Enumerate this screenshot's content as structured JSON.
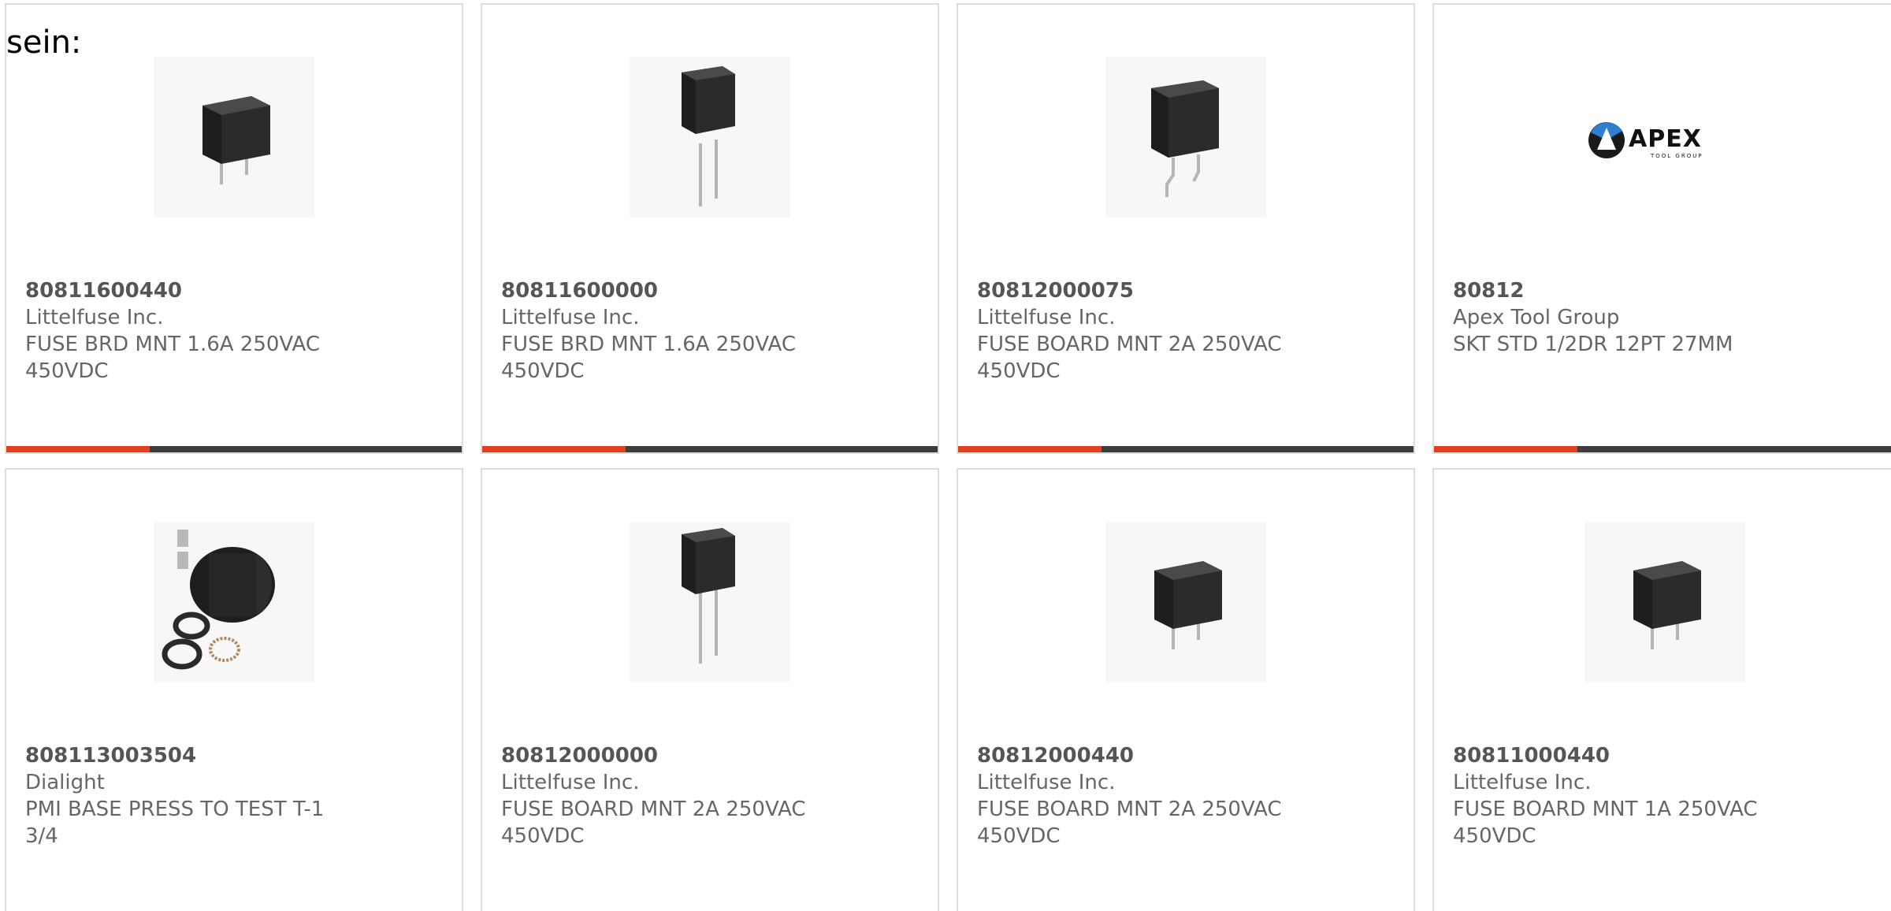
{
  "intro_text": "sein:",
  "colors": {
    "accent": "#e2401c",
    "bar": "#3d3d3d",
    "border": "#dddddd",
    "text": "#666666"
  },
  "products": [
    {
      "part_number": "80811600440",
      "manufacturer": "Littelfuse Inc.",
      "description": "FUSE BRD MNT 1.6A 250VAC 450VDC",
      "image": "fuse-short-leads"
    },
    {
      "part_number": "80811600000",
      "manufacturer": "Littelfuse Inc.",
      "description": "FUSE BRD MNT 1.6A 250VAC 450VDC",
      "image": "fuse-long-leads"
    },
    {
      "part_number": "80812000075",
      "manufacturer": "Littelfuse Inc.",
      "description": "FUSE BOARD MNT 2A 250VAC 450VDC",
      "image": "fuse-bent-leads"
    },
    {
      "part_number": "80812",
      "manufacturer": "Apex Tool Group",
      "description": "SKT STD 1/2DR 12PT 27MM",
      "image": "apex-logo",
      "logo_text": "APEX",
      "logo_subtext": "TOOL GROUP"
    },
    {
      "part_number": "808113003504",
      "manufacturer": "Dialight",
      "description": "PMI BASE PRESS TO TEST T-1 3/4",
      "image": "lamp-socket"
    },
    {
      "part_number": "80812000000",
      "manufacturer": "Littelfuse Inc.",
      "description": "FUSE BOARD MNT 2A 250VAC 450VDC",
      "image": "fuse-long-leads"
    },
    {
      "part_number": "80812000440",
      "manufacturer": "Littelfuse Inc.",
      "description": "FUSE BOARD MNT 2A 250VAC 450VDC",
      "image": "fuse-short-leads"
    },
    {
      "part_number": "80811000440",
      "manufacturer": "Littelfuse Inc.",
      "description": "FUSE BOARD MNT 1A 250VAC 450VDC",
      "image": "fuse-short-leads"
    }
  ]
}
